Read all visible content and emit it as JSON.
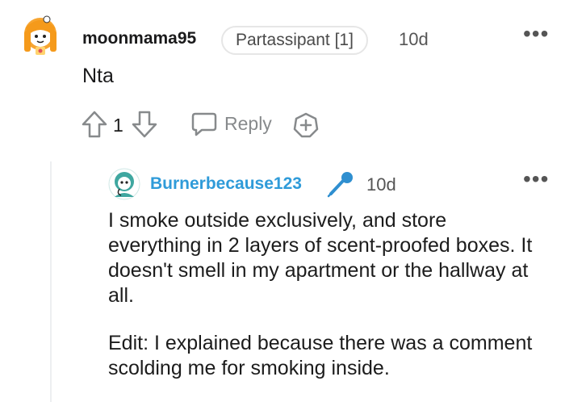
{
  "comment": {
    "username": "moonmama95",
    "flair": "Partassipant [1]",
    "age": "10d",
    "body": "Nta",
    "vote_count": "1",
    "reply_label": "Reply",
    "more_icon": "more-dots-icon",
    "upvote_icon": "upvote-arrow-icon",
    "downvote_icon": "downvote-arrow-icon",
    "reply_icon": "speech-bubble-icon",
    "award_icon": "award-plus-icon"
  },
  "reply": {
    "username": "Burnerbecause123",
    "badge_icon": "microphone-icon",
    "age": "10d",
    "paragraph_1": "I smoke outside exclusively, and store everything in 2 layers of scent-proofed boxes. It doesn't smell in my apartment or the hallway at all.",
    "paragraph_2": "Edit: I explained because there was a comment scolding me for smoking inside.",
    "more_icon": "more-dots-icon"
  },
  "colors": {
    "reply_username": "#2f9bd9",
    "avatar_orange": "#f5a623",
    "avatar_teal": "#3fa7a0"
  }
}
